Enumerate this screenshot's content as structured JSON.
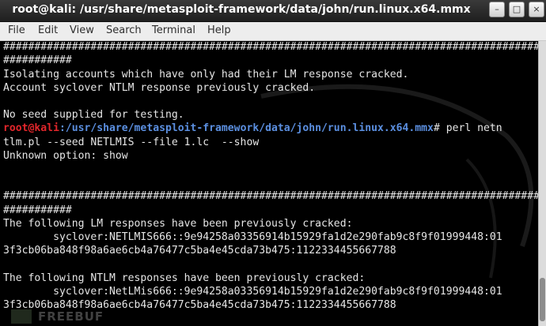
{
  "window": {
    "title": "root@kali: /usr/share/metasploit-framework/data/john/run.linux.x64.mmx",
    "buttons": {
      "minimize": "–",
      "maximize": "□",
      "close": "×"
    }
  },
  "menubar": {
    "items": [
      "File",
      "Edit",
      "View",
      "Search",
      "Terminal",
      "Help"
    ]
  },
  "terminal": {
    "lines": [
      "######################################################################################",
      "###########",
      "Isolating accounts which have only had their LM response cracked.",
      "Account syclover NTLM response previously cracked.",
      "",
      "No seed supplied for testing.",
      "",
      "tlm.pl --seed NETLMIS --file 1.lc  --show",
      "Unknown option: show",
      "",
      "",
      "######################################################################################",
      "###########",
      "The following LM responses have been previously cracked:",
      "        syclover:NETLMIS666::9e94258a03356914b15929fa1d2e290fab9c8f9f01999448:01",
      "3f3cb06ba848f98a6ae6cb4a76477c5ba4e45cda73b475:1122334455667788",
      "",
      "The following NTLM responses have been previously cracked:",
      "        syclover:NetLMis666::9e94258a03356914b15929fa1d2e290fab9c8f9f01999448:01",
      "3f3cb06ba848f98a6ae6cb4a76477c5ba4e45cda73b475:1122334455667788"
    ],
    "prompt": {
      "user_host": "root@kali",
      "path": ":/usr/share/metasploit-framework/data/john/run.linux.x64.mmx",
      "symbol": "# ",
      "command": "perl netn"
    }
  },
  "watermark": {
    "text": "FREEBUF"
  },
  "colors": {
    "prompt_user": "#e2262b",
    "prompt_path": "#5b8fe0",
    "text": "#e6e6e6",
    "background": "#000000"
  }
}
